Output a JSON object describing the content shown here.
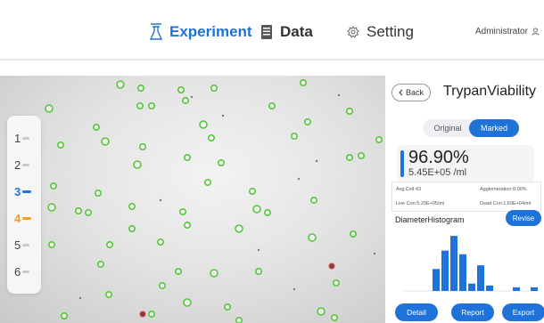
{
  "nav": {
    "experiment": "Experiment",
    "data": "Data",
    "setting": "Setting",
    "user": "Administrator",
    "active_color": "#1f73d8"
  },
  "channels": [
    "1",
    "2",
    "3",
    "4",
    "5",
    "6"
  ],
  "panel": {
    "back": "Back",
    "title": "TrypanViability",
    "view_original": "Original",
    "view_marked": "Marked",
    "viability": "96.90%",
    "concentration": "5.45E+05 /ml",
    "avg_cell": "Avg.Cell:43",
    "agglomeration": "Agglomeration:0.00%",
    "live_con": "Live Con:5.29E+05/ml",
    "dead_con": "Dead Con:1.69E+04/ml",
    "histogram_title": "DiameterHistogram",
    "revise": "Revise",
    "detail": "Detail",
    "report": "Report",
    "export": "Export"
  },
  "histogram": {
    "values": [
      0,
      0,
      0,
      12,
      22,
      30,
      20,
      4,
      14,
      3,
      0,
      0,
      2,
      0,
      2
    ],
    "color": "#1f73d8"
  },
  "icons": [
    "flask-icon",
    "document-icon",
    "gear-icon",
    "user-icon",
    "chevron-left-icon"
  ]
}
